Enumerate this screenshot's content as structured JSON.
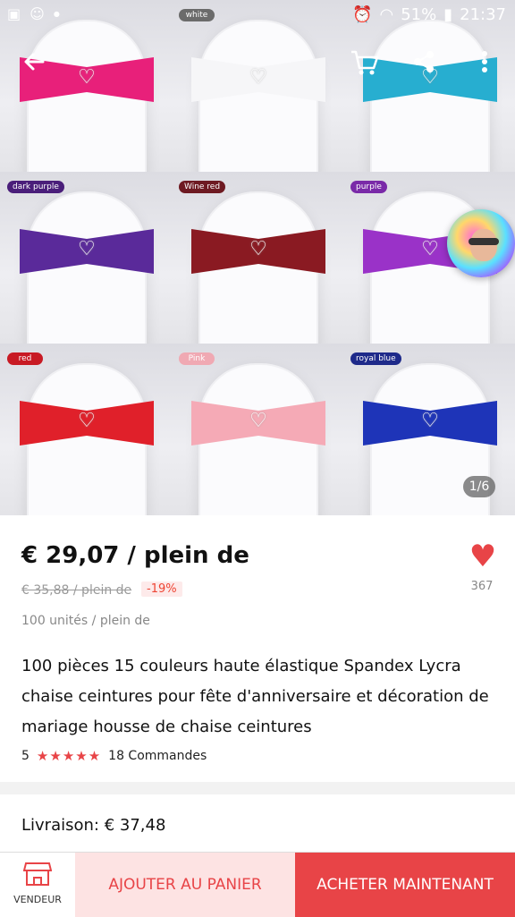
{
  "status_bar": {
    "battery": "51%",
    "time": "21:37"
  },
  "gallery": {
    "tiles": [
      {
        "tag": "",
        "tag_color": "#c0506e",
        "sash_color": "#e8207a"
      },
      {
        "tag": "white",
        "tag_color": "#6b6b6b",
        "sash_color": "#f6f6f8"
      },
      {
        "tag": "",
        "tag_color": "#3f9fb0",
        "sash_color": "#27aed0"
      },
      {
        "tag": "dark purple",
        "tag_color": "#4a1e7a",
        "sash_color": "#5a2a9a"
      },
      {
        "tag": "Wine red",
        "tag_color": "#6e1a22",
        "sash_color": "#8a1a22"
      },
      {
        "tag": "purple",
        "tag_color": "#7a2aa8",
        "sash_color": "#9a32c8"
      },
      {
        "tag": "red",
        "tag_color": "#c81a24",
        "sash_color": "#e0202a"
      },
      {
        "tag": "Pink",
        "tag_color": "#f0a9b3",
        "sash_color": "#f5aab6"
      },
      {
        "tag": "royal blue",
        "tag_color": "#1e2a8a",
        "sash_color": "#1e34b8"
      }
    ],
    "page_indicator": "1/6"
  },
  "product": {
    "price": "€ 29,07 / plein de",
    "old_price": "€ 35,88 / plein de",
    "discount": "-19%",
    "likes": "367",
    "units": "100 unités / plein de",
    "title": "100 pièces 15 couleurs haute élastique Spandex Lycra chaise ceintures pour fête d'anniversaire et décoration de mariage housse de chaise ceintures",
    "rating": "5",
    "stars": "★★★★★",
    "orders": "18 Commandes"
  },
  "delivery": {
    "label": "Livraison: € 37,48"
  },
  "actions": {
    "vendor": "VENDEUR",
    "add_to_cart": "AJOUTER AU PANIER",
    "buy_now": "ACHETER MAINTENANT"
  },
  "colors": {
    "accent": "#e84447",
    "accent_light": "#fde3e3"
  }
}
